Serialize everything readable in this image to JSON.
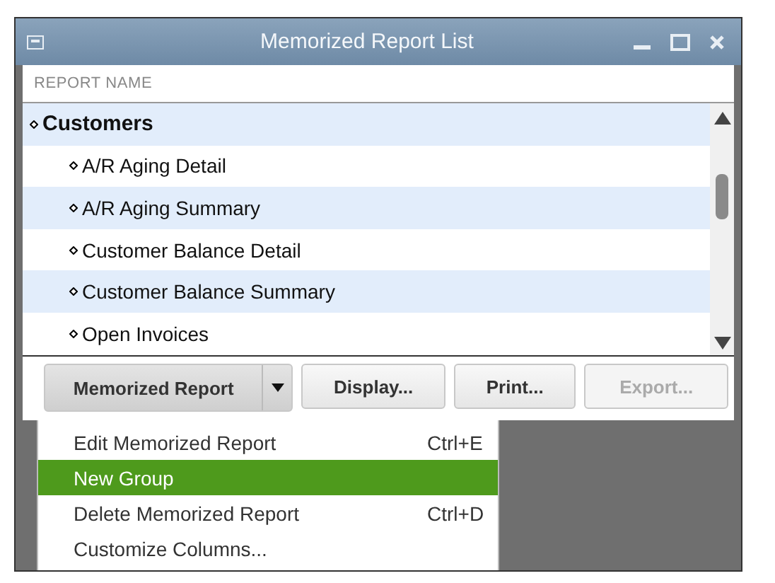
{
  "window": {
    "title": "Memorized Report List"
  },
  "column_header": "REPORT NAME",
  "rows": [
    {
      "label": "Customers",
      "kind": "group"
    },
    {
      "label": "A/R Aging Detail",
      "kind": "report"
    },
    {
      "label": "A/R Aging Summary",
      "kind": "report"
    },
    {
      "label": "Customer Balance Detail",
      "kind": "report"
    },
    {
      "label": "Customer Balance Summary",
      "kind": "report"
    },
    {
      "label": "Open Invoices",
      "kind": "report"
    }
  ],
  "buttons": [
    {
      "label": "Memorized Report",
      "kind": "split",
      "disabled": false
    },
    {
      "label": "Display...",
      "kind": "plain",
      "disabled": false
    },
    {
      "label": "Print...",
      "kind": "plain",
      "disabled": false
    },
    {
      "label": "Export...",
      "kind": "plain",
      "disabled": true
    }
  ],
  "menu": {
    "items": [
      {
        "label": "Edit Memorized Report",
        "shortcut": "Ctrl+E",
        "selected": false
      },
      {
        "label": "New Group",
        "selected": true
      },
      {
        "label": "Delete Memorized Report",
        "shortcut": "Ctrl+D",
        "selected": false
      },
      {
        "label": "Customize Columns...",
        "selected": false
      }
    ]
  }
}
